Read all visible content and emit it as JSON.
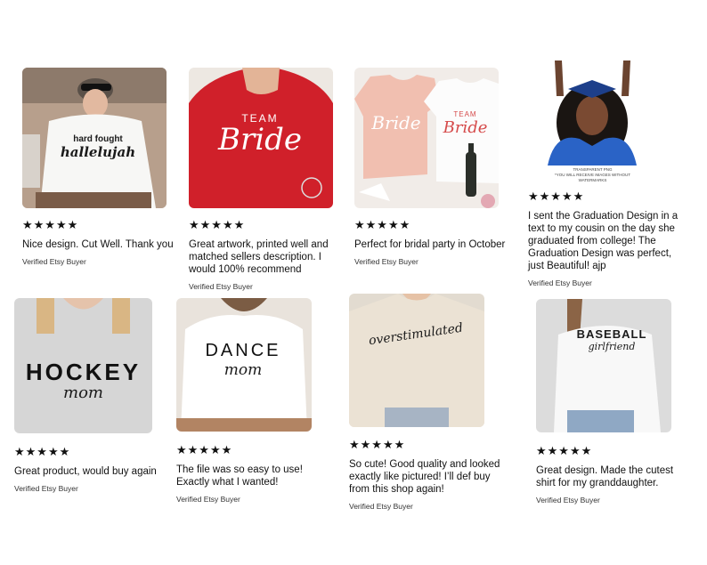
{
  "reviews": [
    {
      "stars": "★★★★★",
      "text": "Nice design. Cut Well. Thank you",
      "buyer": "Verified Etsy Buyer",
      "print": [
        "hard fought",
        "hallelujah"
      ]
    },
    {
      "stars": "★★★★★",
      "text": "Great artwork, printed well and matched sellers description. I would 100% recommend",
      "buyer": "Verified Etsy Buyer",
      "print": [
        "TEAM",
        "Bride"
      ]
    },
    {
      "stars": "★★★★★",
      "text": "Perfect for bridal party in October",
      "buyer": "Verified Etsy Buyer",
      "print": [
        "Bride",
        "TEAM",
        "Bride"
      ]
    },
    {
      "stars": "★★★★★",
      "text": "I sent the Graduation Design in a text to my cousin on the day she graduated from  college! The Graduation Design was perfect, just Beautiful! ajp",
      "buyer": "Verified Etsy Buyer",
      "print": [
        "TRANSPARENT PNG",
        "*YOU WILL RECEIVE IMAGES WITHOUT WATERMARKS"
      ]
    },
    {
      "stars": "★★★★★",
      "text": "Great product, would buy again",
      "buyer": "Verified Etsy Buyer",
      "print": [
        "HOCKEY",
        "mom"
      ]
    },
    {
      "stars": "★★★★★",
      "text": "The file was so easy to use! Exactly what I wanted!",
      "buyer": "Verified Etsy Buyer",
      "print": [
        "DANCE",
        "mom"
      ]
    },
    {
      "stars": "★★★★★",
      "text": "So cute! Good quality and looked exactly like pictured! I’ll def buy from this shop again!",
      "buyer": "Verified Etsy Buyer",
      "print": [
        "overstimulated"
      ]
    },
    {
      "stars": "★★★★★",
      "text": "Great design. Made the cutest shirt for my granddaughter.",
      "buyer": "Verified Etsy Buyer",
      "print": [
        "BASEBALL",
        "girlfriend"
      ]
    }
  ]
}
